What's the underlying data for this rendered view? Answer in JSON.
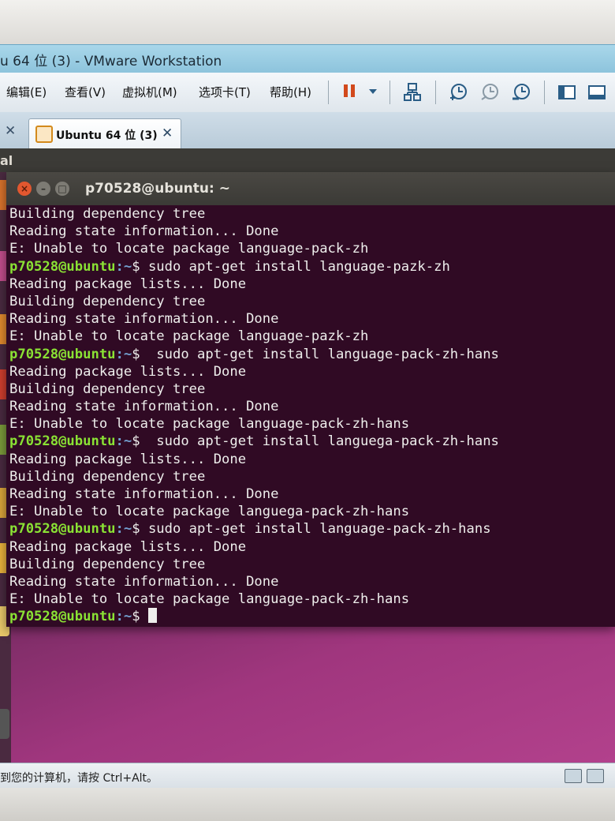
{
  "window": {
    "title": "u 64 位 (3) - VMware Workstation"
  },
  "menubar": {
    "items": [
      "编辑(E)",
      "查看(V)",
      "虚拟机(M)",
      "选项卡(T)",
      "帮助(H)"
    ]
  },
  "toolbar": {
    "icons": [
      "pause-icon",
      "dropdown-arrow-icon",
      "network-icon",
      "snapshot-take-icon",
      "snapshot-revert-icon",
      "snapshot-manager-icon",
      "view-console-icon",
      "view-fullscreen-icon"
    ]
  },
  "tabs": {
    "active_label": "Ubuntu 64 位 (3)"
  },
  "ubuntu": {
    "panel_app": "al",
    "terminal_title": "p70528@ubuntu: ~"
  },
  "terminal": {
    "prompt_user": "p70528@ubuntu",
    "prompt_path": ":~",
    "prompt_symbol": "$",
    "lines": [
      {
        "type": "out",
        "text": "Building dependency tree"
      },
      {
        "type": "out",
        "text": "Reading state information... Done"
      },
      {
        "type": "out",
        "text": "E: Unable to locate package language-pack-zh"
      },
      {
        "type": "cmd",
        "text": " sudo apt-get install language-pazk-zh"
      },
      {
        "type": "out",
        "text": "Reading package lists... Done"
      },
      {
        "type": "out",
        "text": "Building dependency tree"
      },
      {
        "type": "out",
        "text": "Reading state information... Done"
      },
      {
        "type": "out",
        "text": "E: Unable to locate package language-pazk-zh"
      },
      {
        "type": "cmd",
        "text": "  sudo apt-get install language-pack-zh-hans"
      },
      {
        "type": "out",
        "text": "Reading package lists... Done"
      },
      {
        "type": "out",
        "text": "Building dependency tree"
      },
      {
        "type": "out",
        "text": "Reading state information... Done"
      },
      {
        "type": "out",
        "text": "E: Unable to locate package language-pack-zh-hans"
      },
      {
        "type": "cmd",
        "text": "  sudo apt-get install languega-pack-zh-hans"
      },
      {
        "type": "out",
        "text": "Reading package lists... Done"
      },
      {
        "type": "out",
        "text": "Building dependency tree"
      },
      {
        "type": "out",
        "text": "Reading state information... Done"
      },
      {
        "type": "out",
        "text": "E: Unable to locate package languega-pack-zh-hans"
      },
      {
        "type": "cmd",
        "text": " sudo apt-get install language-pack-zh-hans"
      },
      {
        "type": "out",
        "text": "Reading package lists... Done"
      },
      {
        "type": "out",
        "text": "Building dependency tree"
      },
      {
        "type": "out",
        "text": "Reading state information... Done"
      },
      {
        "type": "out",
        "text": "E: Unable to locate package language-pack-zh-hans"
      },
      {
        "type": "cmd",
        "text": " "
      }
    ]
  },
  "statusbar": {
    "hint": "到您的计算机，请按 Ctrl+Alt。"
  }
}
